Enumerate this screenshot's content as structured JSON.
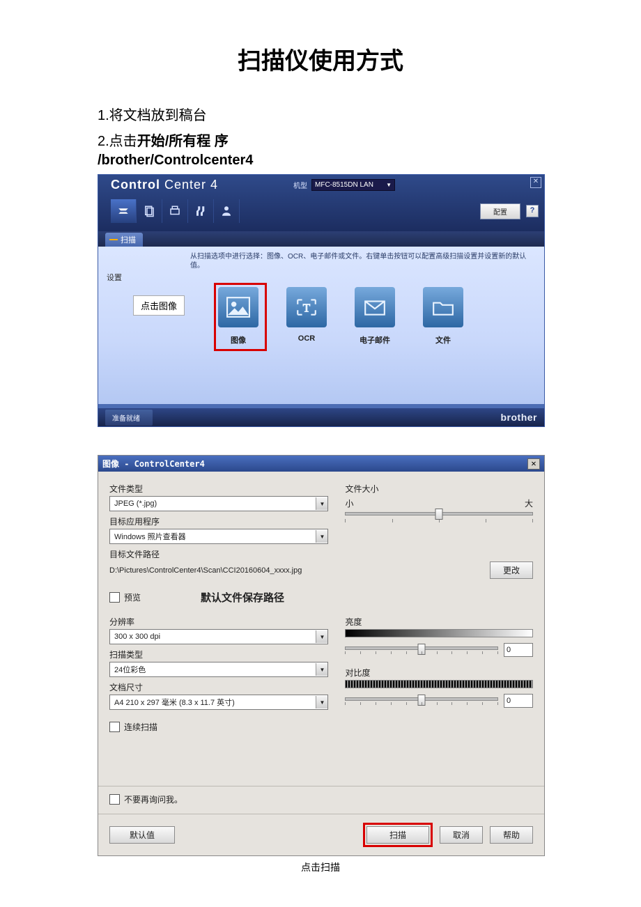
{
  "doc": {
    "title": "扫描仪使用方式",
    "step1": "1.将文档放到稿台",
    "step2_prefix": "2.点击",
    "step2_bold1": "开始",
    "step2_sep": "/",
    "step2_bold2": "所有程 序",
    "step2_line2": "/brother/Controlcenter4",
    "scan_note": "点击扫描"
  },
  "cc4": {
    "logo_bold": "Control",
    "logo_light": " Center 4",
    "model_label": "机型",
    "model_value": "MFC-8515DN LAN",
    "btn_config": "配置",
    "tab_scan": "扫描",
    "hint": "从扫描选项中进行选择：图像、OCR、电子邮件或文件。右键单击按钮可以配置高级扫描设置并设置新的默认值。",
    "side_label": "设置",
    "callout": "点击图像",
    "items": {
      "image": "图像",
      "ocr": "OCR",
      "email": "电子邮件",
      "file": "文件"
    },
    "status": "准备就绪",
    "brand": "brother"
  },
  "dlg": {
    "title": "图像 - ControlCenter4",
    "labels": {
      "filetype": "文件类型",
      "filesize": "文件大小",
      "size_small": "小",
      "size_large": "大",
      "target_app": "目标应用程序",
      "target_path": "目标文件路径",
      "change": "更改",
      "preview": "预览",
      "default_save_note": "默认文件保存路径",
      "resolution": "分辨率",
      "scan_type": "扫描类型",
      "doc_size": "文档尺寸",
      "continuous": "连续扫描",
      "brightness": "亮度",
      "contrast": "对比度",
      "dont_ask": "不要再询问我。"
    },
    "values": {
      "filetype": "JPEG (*.jpg)",
      "target_app": "Windows 照片查看器",
      "path": "D:\\Pictures\\ControlCenter4\\Scan\\CCI20160604_xxxx.jpg",
      "resolution": "300 x 300 dpi",
      "scan_type": "24位彩色",
      "doc_size": "A4 210 x 297 毫米 (8.3 x 11.7 英寸)",
      "brightness": "0",
      "contrast": "0"
    },
    "buttons": {
      "default": "默认值",
      "scan": "扫描",
      "cancel": "取消",
      "help": "帮助"
    }
  }
}
